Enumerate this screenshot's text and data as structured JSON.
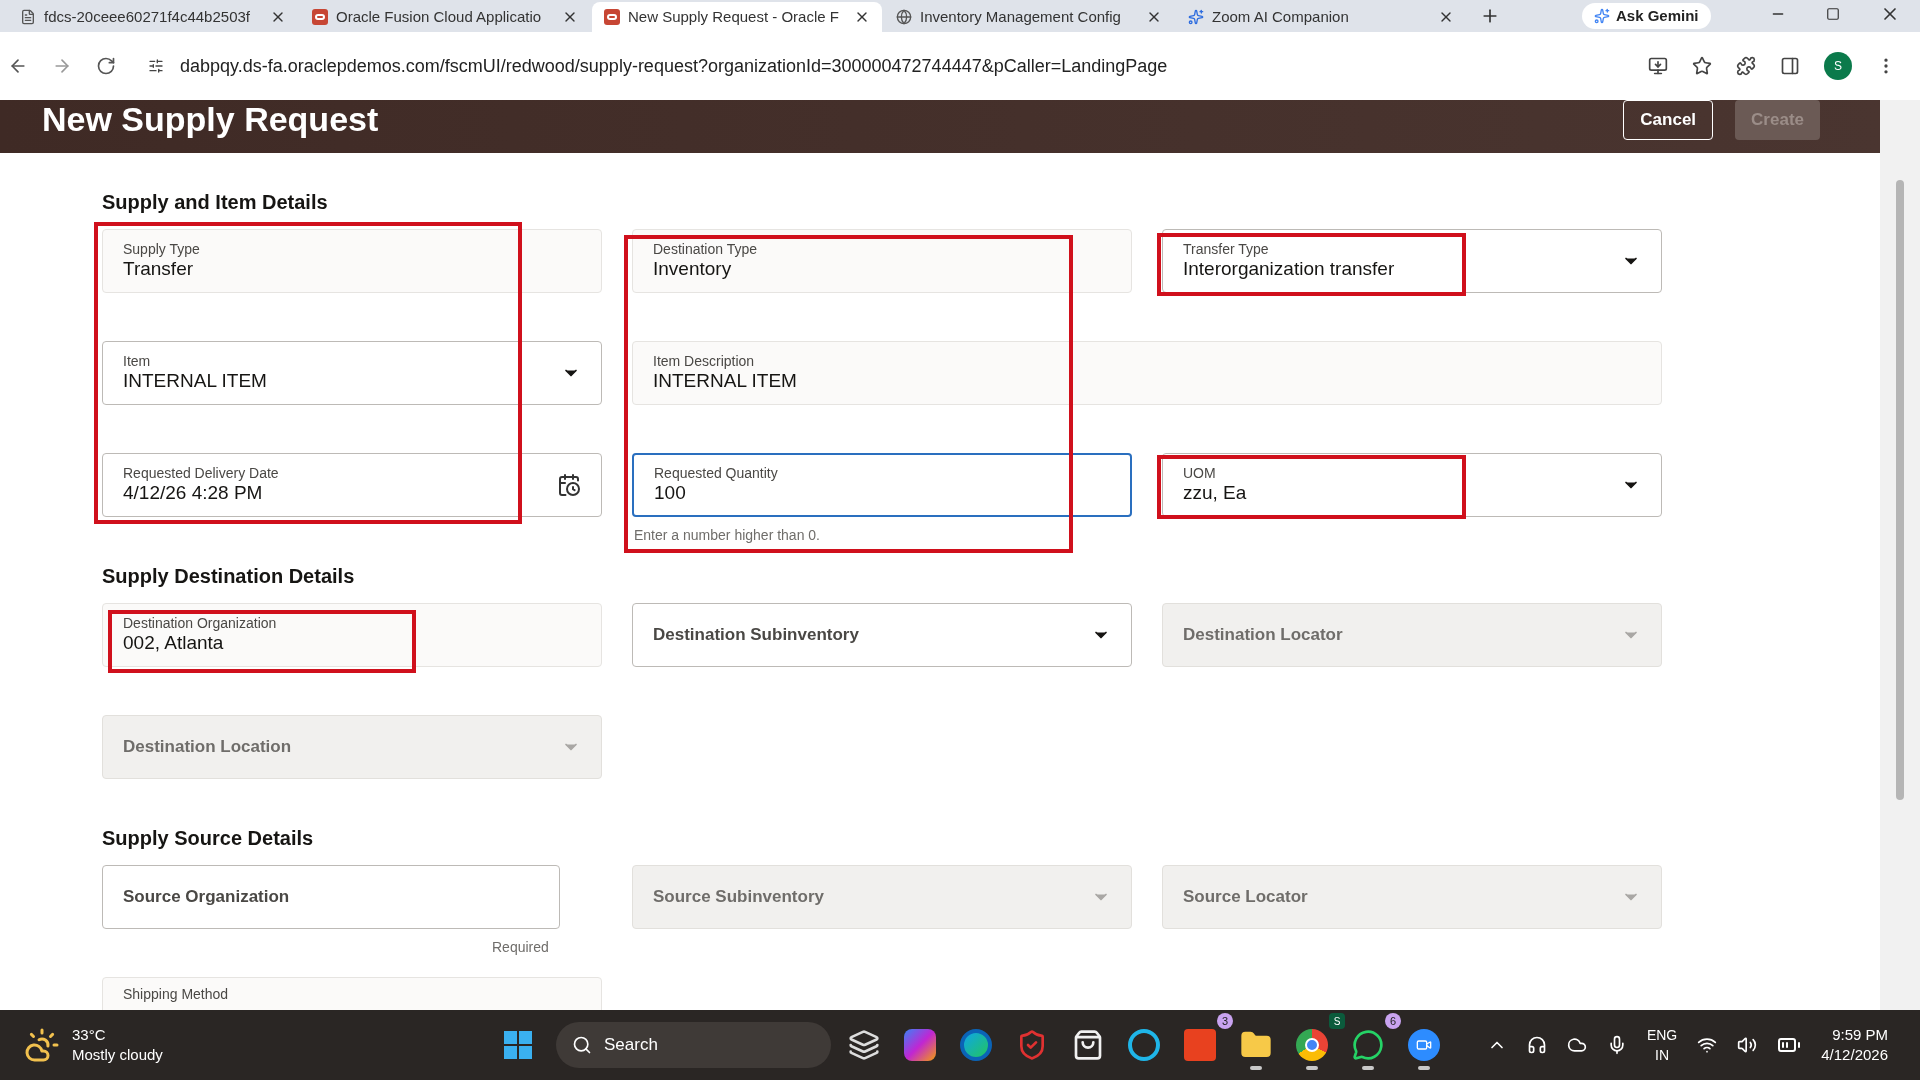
{
  "browser": {
    "tabs": [
      {
        "title": "fdcs-20ceee60271f4c44b2503f",
        "kind": "page",
        "selected": false
      },
      {
        "title": "Oracle Fusion Cloud Applicatio",
        "kind": "oracle",
        "selected": false
      },
      {
        "title": "New Supply Request - Oracle F",
        "kind": "oracle",
        "selected": true
      },
      {
        "title": "Inventory Management Config",
        "kind": "globe",
        "selected": false
      },
      {
        "title": "Zoom AI Companion",
        "kind": "sparkle",
        "selected": false
      }
    ],
    "ask_gemini": "Ask Gemini",
    "address": "dabpqy.ds-fa.oraclepdemos.com/fscmUI/redwood/supply-request?organizationId=300000472744447&pCaller=LandingPage",
    "profile": "S"
  },
  "page": {
    "title": "New Supply Request",
    "buttons": [
      {
        "label": "Cancel",
        "disabled": false
      },
      {
        "label": "Create",
        "disabled": true
      }
    ],
    "sections": [
      {
        "title": "Supply and Item Details",
        "rows": [
          [
            {
              "label": "Supply Type",
              "value": "Transfer",
              "kind": "display",
              "disabled": false,
              "focused": false
            },
            {
              "label": "Destination Type",
              "value": "Inventory",
              "kind": "display",
              "disabled": false,
              "focused": false
            },
            {
              "label": "Transfer Type",
              "value": "Interorganization transfer",
              "kind": "select",
              "disabled": false,
              "focused": false
            }
          ],
          [
            {
              "label": "Item",
              "value": "INTERNAL ITEM",
              "kind": "select",
              "disabled": false,
              "focused": false
            },
            {
              "label": "Item Description",
              "value": "INTERNAL ITEM",
              "kind": "display-wide",
              "disabled": false,
              "focused": false
            }
          ],
          [
            {
              "label": "Requested Delivery Date",
              "value": "4/12/26 4:28 PM",
              "kind": "date",
              "disabled": false,
              "focused": false
            },
            {
              "label": "Requested Quantity",
              "value": "100",
              "kind": "input",
              "disabled": false,
              "focused": true,
              "helper": "Enter a number higher than 0."
            },
            {
              "label": "UOM",
              "value": "zzu,  Ea",
              "kind": "select",
              "disabled": false,
              "focused": false
            }
          ]
        ]
      },
      {
        "title": "Supply Destination Details",
        "rows": [
          [
            {
              "label": "Destination Organization",
              "value": "002, Atlanta",
              "kind": "display",
              "disabled": false,
              "focused": false
            },
            {
              "label": "Destination Subinventory",
              "kind": "select",
              "disabled": false,
              "focused": false
            },
            {
              "label": "Destination Locator",
              "kind": "select",
              "disabled": true,
              "focused": false
            }
          ],
          [
            {
              "label": "Destination Location",
              "kind": "select",
              "disabled": true,
              "focused": false
            }
          ]
        ]
      },
      {
        "title": "Supply Source Details",
        "rows": [
          [
            {
              "label": "Source Organization",
              "kind": "input-short",
              "disabled": false,
              "focused": false,
              "helper": "Required"
            },
            {
              "label": "Source Subinventory",
              "kind": "select",
              "disabled": true,
              "focused": false
            },
            {
              "label": "Source Locator",
              "kind": "select",
              "disabled": true,
              "focused": false
            }
          ],
          [
            {
              "label": "Shipping Method",
              "kind": "display",
              "disabled": false,
              "focused": false
            }
          ]
        ]
      }
    ]
  },
  "annotations": [
    {
      "kind": "highlight"
    },
    {
      "kind": "highlight"
    },
    {
      "kind": "highlight"
    },
    {
      "kind": "highlight"
    },
    {
      "kind": "highlight"
    }
  ],
  "taskbar": {
    "weather": {
      "temperature": "33°C",
      "condition": "Mostly cloudy"
    },
    "search": "Search",
    "apps": [
      {
        "kind": "taskview"
      },
      {
        "kind": "copilot"
      },
      {
        "kind": "edge"
      },
      {
        "kind": "shield"
      },
      {
        "kind": "store"
      },
      {
        "kind": "ring"
      },
      {
        "kind": "letter",
        "badge": "3"
      },
      {
        "kind": "folder",
        "running": true
      },
      {
        "kind": "chrome",
        "running": true,
        "avatar": "S"
      },
      {
        "kind": "whatsapp",
        "badge": "6",
        "running": true
      },
      {
        "kind": "zoom",
        "running": true
      }
    ],
    "language": [
      "ENG",
      "IN"
    ],
    "time": "9:59 PM",
    "date": "4/12/2026"
  }
}
